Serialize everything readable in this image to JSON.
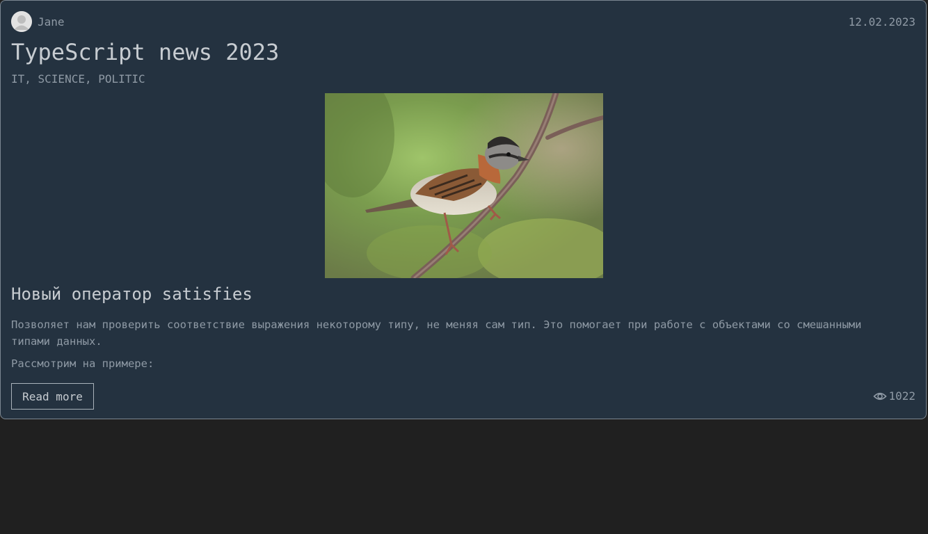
{
  "post": {
    "author": "Jane",
    "date": "12.02.2023",
    "title": "TypeScript news 2023",
    "tags": "IT, SCIENCE, POLITIC",
    "image_icon": "sparrow-on-branch-photo",
    "subtitle": "Новый оператор satisfies",
    "paragraphs": [
      "Позволяет нам проверить соответствие выражения некоторому типу, не меняя сам тип. Это помогает при работе с объектами со смешанными типами данных.",
      "Рассмотрим на примере:"
    ],
    "read_more_label": "Read more",
    "views": "1022"
  }
}
